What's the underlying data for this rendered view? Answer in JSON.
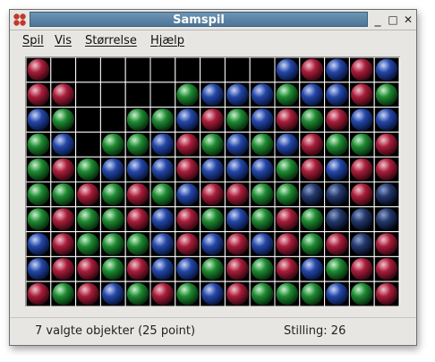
{
  "window": {
    "title": "Samspil",
    "controls": [
      "_",
      "□",
      "✕"
    ]
  },
  "menu": [
    {
      "label": "Spil"
    },
    {
      "label": "Vis"
    },
    {
      "label": "Størrelse"
    },
    {
      "label": "Hjælp"
    }
  ],
  "board": {
    "columns": 15,
    "rows": 10,
    "legend": {
      "R": "red ball",
      "G": "green ball",
      "B": "blue ball",
      "X": "empty cell",
      "S": "selected blue ball"
    },
    "colors": {
      "R": "#a81d3a",
      "G": "#1f8a32",
      "B": "#2447a8",
      "X": "#000000",
      "S": "#24386a",
      "grid": "#ffffff"
    },
    "grid": [
      "RXXXXXXXXXBRBRB",
      "RRXXXXGBBBGBBRG",
      "BGXXGGBRGBRGRBB",
      "GBXGGBRGBGBRGGR",
      "GRGBBBRBBBGRBRR",
      "GGRGRGBRRGGSSRS",
      "GRGGRBRGBGRGSSS",
      "BRGGGBRBRBRGRSR",
      "BRRGRBBGRGRBGRR",
      "RGRBGRGBRGGGBGR"
    ]
  },
  "status": {
    "selection": "7 valgte objekter (25 point)",
    "score": "Stilling: 26"
  }
}
